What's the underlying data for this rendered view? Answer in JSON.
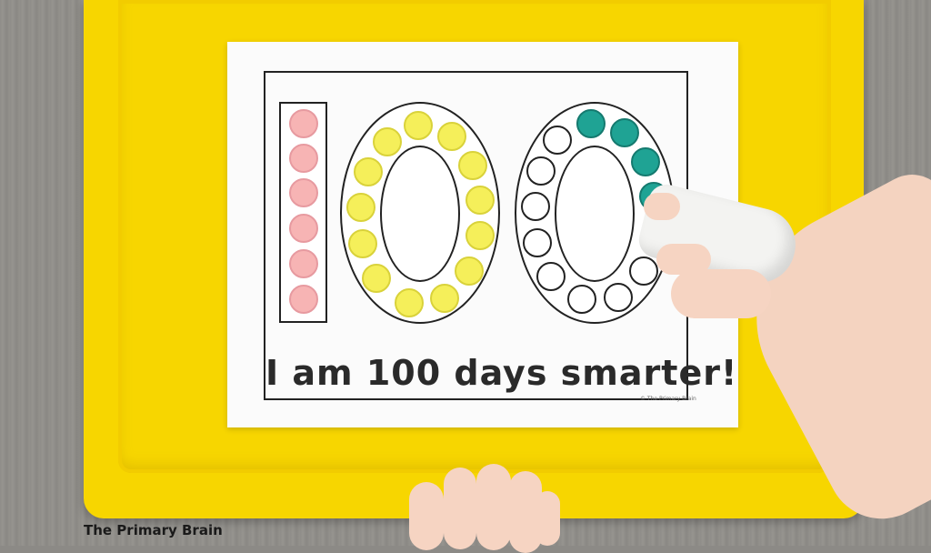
{
  "worksheet": {
    "sentence": "I am 100 days smarter!",
    "credit": "© The Primary Brain"
  },
  "watermark": "The Primary Brain",
  "colors": {
    "tray": "#f7d600",
    "pink_dot": "#f7b4b4",
    "yellow_dot": "#f5ef5a",
    "teal_dot": "#1fa394"
  },
  "digits": [
    "1",
    "0",
    "0"
  ]
}
